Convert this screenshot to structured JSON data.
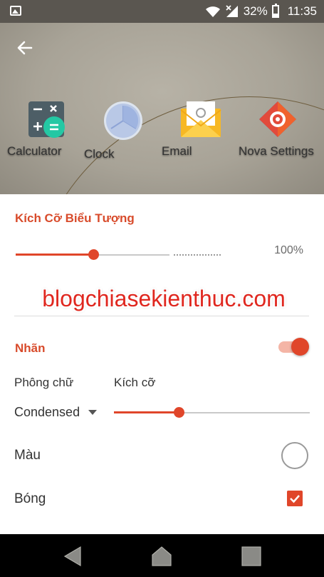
{
  "status_bar": {
    "battery_percent": "32%",
    "time": "11:35",
    "icons": [
      "gallery-icon",
      "wifi-icon",
      "signal-icon",
      "battery-icon"
    ]
  },
  "preview": {
    "apps": [
      {
        "name": "Calculator",
        "icon": "calculator-icon"
      },
      {
        "name": "Clock",
        "icon": "clock-icon"
      },
      {
        "name": "Email",
        "icon": "email-icon"
      },
      {
        "name": "Nova Settings",
        "icon": "nova-settings-icon"
      }
    ]
  },
  "icon_size": {
    "title": "Kích Cỡ Biểu Tượng",
    "value_text": "100%",
    "slider_fraction": 0.5
  },
  "watermark": "blogchiasekienthuc.com",
  "label_section": {
    "title": "Nhãn",
    "toggle_on": true,
    "font_label": "Phông chữ",
    "size_label": "Kích cỡ",
    "font_value": "Condensed",
    "size_slider_fraction": 0.33,
    "color_label": "Màu",
    "shadow_label": "Bóng",
    "shadow_checked": true
  },
  "colors": {
    "accent": "#e0462a",
    "title": "#d84b2b",
    "toggle_track": "#f4b5a6"
  }
}
